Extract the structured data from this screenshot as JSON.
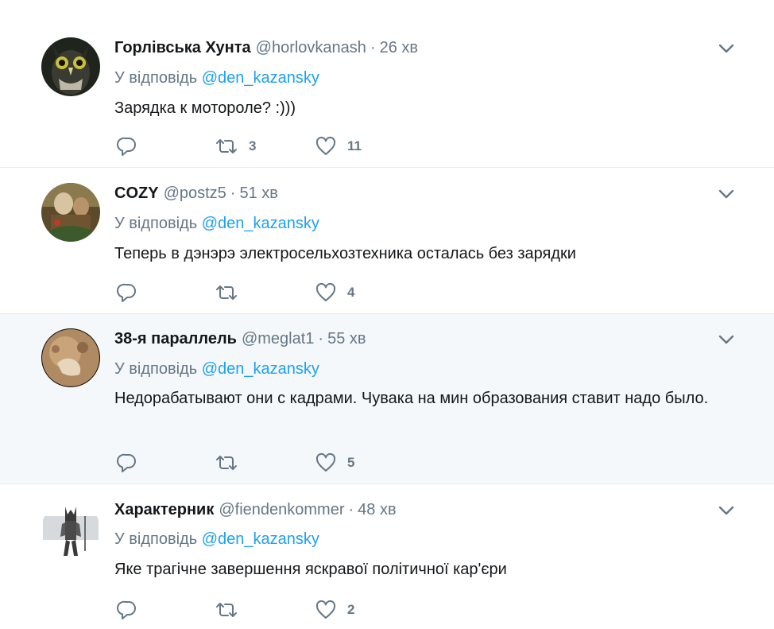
{
  "tweets": [
    {
      "name": "Горлівська Хунта",
      "handle": "@horlovkanash",
      "separator": "·",
      "time": "26 хв",
      "reply_prefix": "У відповідь",
      "reply_to": "@den_kazansky",
      "text": "Зарядка к мотороле? :)))",
      "retweets": "3",
      "likes": "11",
      "avatar_icon": "owl-avatar"
    },
    {
      "name": "COZY",
      "handle": "@postz5",
      "separator": "·",
      "time": "51 хв",
      "reply_prefix": "У відповідь",
      "reply_to": "@den_kazansky",
      "text": "Теперь в дэнэрэ электросельхозтехника осталась без зарядки",
      "retweets": "",
      "likes": "4",
      "avatar_icon": "painting-avatar"
    },
    {
      "name": "38-я параллель",
      "handle": "@meglat1",
      "separator": "·",
      "time": "55 хв",
      "reply_prefix": "У відповідь",
      "reply_to": "@den_kazansky",
      "text": "Недорабатывают они с кадрами. Чувака на мин образования ставит надо было.",
      "retweets": "",
      "likes": "5",
      "avatar_icon": "planet-avatar"
    },
    {
      "name": "Характерник",
      "handle": "@fiendenkommer",
      "separator": "·",
      "time": "48 хв",
      "reply_prefix": "У відповідь",
      "reply_to": "@den_kazansky",
      "text": "Яке трагічне завершення яскравої політичної кар'єри",
      "retweets": "",
      "likes": "2",
      "avatar_icon": "warrior-avatar"
    }
  ],
  "colors": {
    "text": "#14171a",
    "secondary": "#657786",
    "link": "#1da1f2",
    "divider": "#e6ecf0",
    "highlight_bg": "#f5f8fa"
  },
  "icons": {
    "reply": "reply-icon",
    "retweet": "retweet-icon",
    "like": "heart-icon",
    "menu": "chevron-down-icon"
  }
}
